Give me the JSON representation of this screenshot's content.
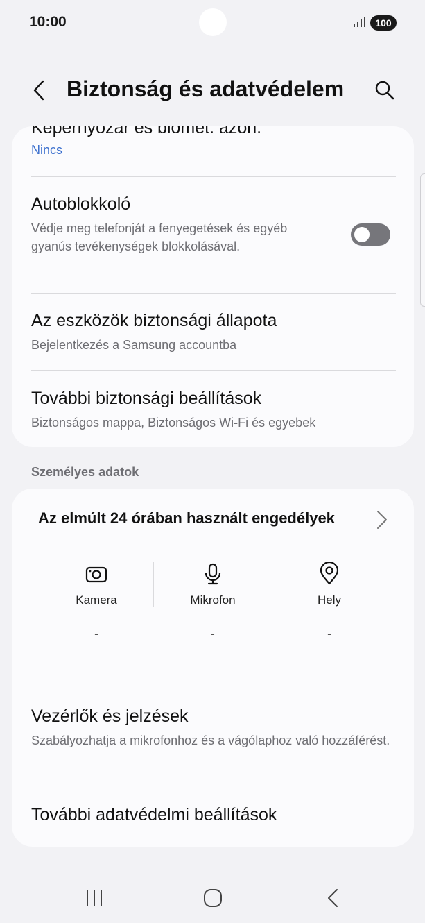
{
  "status_bar": {
    "time": "10:00",
    "battery": "100"
  },
  "header": {
    "title": "Biztonság és adatvédelem"
  },
  "security_card": {
    "screen_lock": {
      "title": "Képernyőzár és biomet. azon.",
      "subtitle": "Nincs"
    },
    "auto_blocker": {
      "title": "Autoblokkoló",
      "subtitle": "Védje meg telefonját a fenyegetések és egyéb gyanús tevékenységek blokkolásával.",
      "enabled": false
    },
    "device_security": {
      "title": "Az eszközök biztonsági állapota",
      "subtitle": "Bejelentkezés a Samsung accountba"
    },
    "more_security": {
      "title": "További biztonsági beállítások",
      "subtitle": "Biztonságos mappa, Biztonságos Wi-Fi és egyebek"
    }
  },
  "personal_section": {
    "label": "Személyes adatok"
  },
  "privacy_card": {
    "permissions_header": "Az elmúlt 24 órában használt engedélyek",
    "permissions": [
      {
        "label": "Kamera",
        "value": "-",
        "icon": "camera-icon"
      },
      {
        "label": "Mikrofon",
        "value": "-",
        "icon": "microphone-icon"
      },
      {
        "label": "Hely",
        "value": "-",
        "icon": "location-pin-icon"
      }
    ],
    "controls_alerts": {
      "title": "Vezérlők és jelzések",
      "subtitle": "Szabályozhatja a mikrofonhoz és a vágólaphoz való hozzáférést."
    },
    "more_privacy": {
      "title": "További adatvédelmi beállítások"
    }
  },
  "colors": {
    "accent": "#3b6fce",
    "background": "#f2f2f5",
    "card": "#fbfbfd",
    "toggle_off": "#76767b"
  }
}
